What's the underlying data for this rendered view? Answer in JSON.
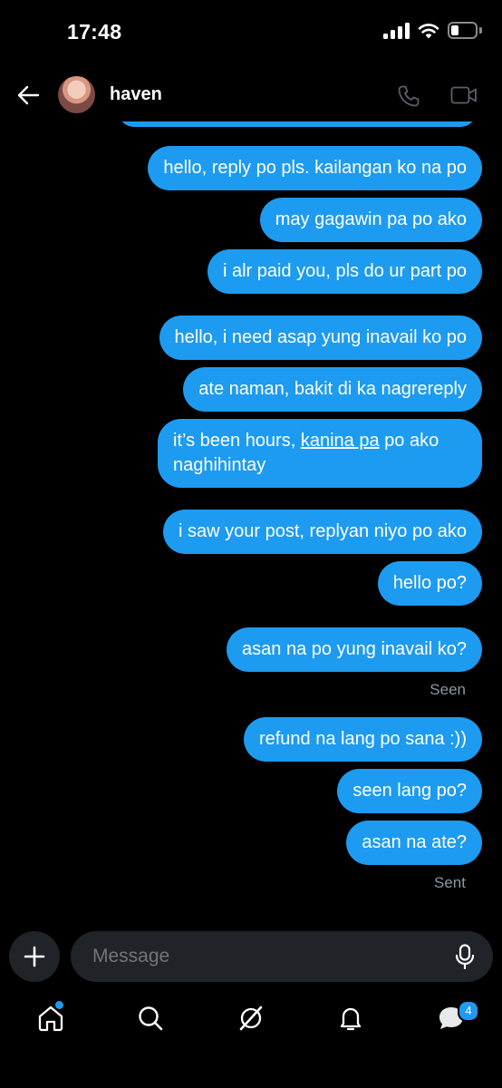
{
  "status_bar": {
    "time": "17:48"
  },
  "header": {
    "contact_name": "haven"
  },
  "messages": [
    {
      "text": "hello, reply po pls. kailangan ko na po"
    },
    {
      "text": "may gagawin pa po ako"
    },
    {
      "text": "i alr paid you, pls do ur part po"
    },
    {
      "text": "hello, i need asap yung inavail ko po"
    },
    {
      "text": "ate naman, bakit di ka nagrereply"
    },
    {
      "text_before": "it’s been hours, ",
      "text_underlined": "kanina pa",
      "text_after": " po ako naghihintay"
    },
    {
      "text": "i saw your post, replyan niyo po ako"
    },
    {
      "text": "hello po?"
    },
    {
      "text": "asan na po yung inavail ko?"
    },
    {
      "text": "refund na lang po sana :))"
    },
    {
      "text": "seen lang po?"
    },
    {
      "text": "asan na ate?"
    }
  ],
  "receipts": {
    "seen": "Seen",
    "sent": "Sent"
  },
  "composer": {
    "placeholder": "Message"
  },
  "nav": {
    "items": [
      "home-icon",
      "search-icon",
      "grok-icon",
      "notifications-icon",
      "messages-icon"
    ],
    "messages_badge": "4"
  },
  "colors": {
    "bubble": "#1d9bf0",
    "background": "#000000",
    "input_bg": "#202327"
  }
}
